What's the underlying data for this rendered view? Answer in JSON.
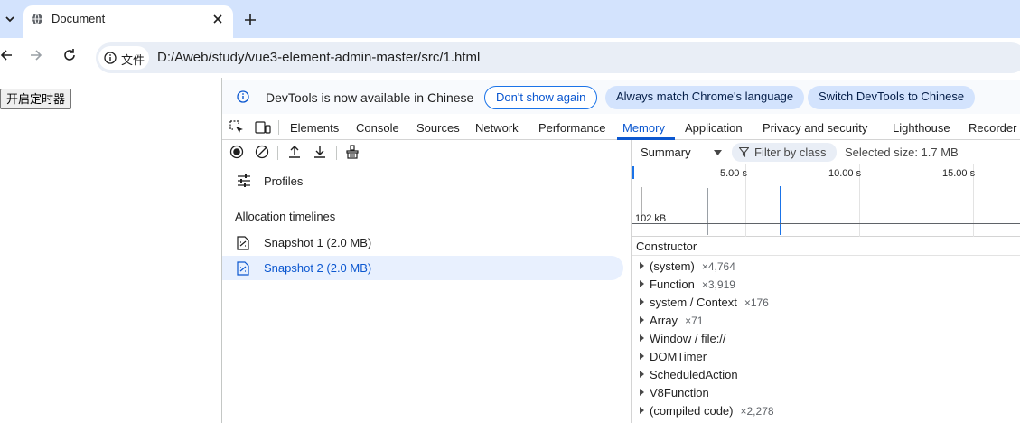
{
  "browser": {
    "tab_title": "Document",
    "chip_text": "文件",
    "url": "D:/Aweb/study/vue3-element-admin-master/src/1.html"
  },
  "page": {
    "button_label": "开启定时器"
  },
  "devtools": {
    "infobar": {
      "message": "DevTools is now available in Chinese",
      "dont_show": "Don't show again",
      "always_match": "Always match Chrome's language",
      "switch": "Switch DevTools to Chinese"
    },
    "tabs": [
      "Elements",
      "Console",
      "Sources",
      "Network",
      "Performance",
      "Memory",
      "Application",
      "Privacy and security",
      "Lighthouse",
      "Recorder"
    ],
    "active_tab": "Memory",
    "memory": {
      "profiles_label": "Profiles",
      "section_title": "Allocation timelines",
      "snapshots": [
        {
          "label": "Snapshot 1 (2.0 MB)",
          "selected": false
        },
        {
          "label": "Snapshot 2 (2.0 MB)",
          "selected": true
        }
      ],
      "view_select": "Summary",
      "filter_placeholder": "Filter by class",
      "selected_size": "Selected size: 1.7 MB",
      "timeline": {
        "ticks": [
          "5.00 s",
          "10.00 s",
          "15.00 s"
        ],
        "size_label": "102 kB"
      },
      "constructor_header": "Constructor",
      "constructors": [
        {
          "name": "(system)",
          "count": "×4,764"
        },
        {
          "name": "Function",
          "count": "×3,919"
        },
        {
          "name": "system / Context",
          "count": "×176"
        },
        {
          "name": "Array",
          "count": "×71"
        },
        {
          "name": "Window / file://",
          "count": ""
        },
        {
          "name": "DOMTimer",
          "count": ""
        },
        {
          "name": "ScheduledAction",
          "count": ""
        },
        {
          "name": "V8Function",
          "count": ""
        },
        {
          "name": "(compiled code)",
          "count": "×2,278"
        }
      ]
    }
  },
  "colors": {
    "accent": "#0b57d0",
    "tabstrip": "#d3e3fd",
    "selected_row": "#e8f0fe"
  }
}
